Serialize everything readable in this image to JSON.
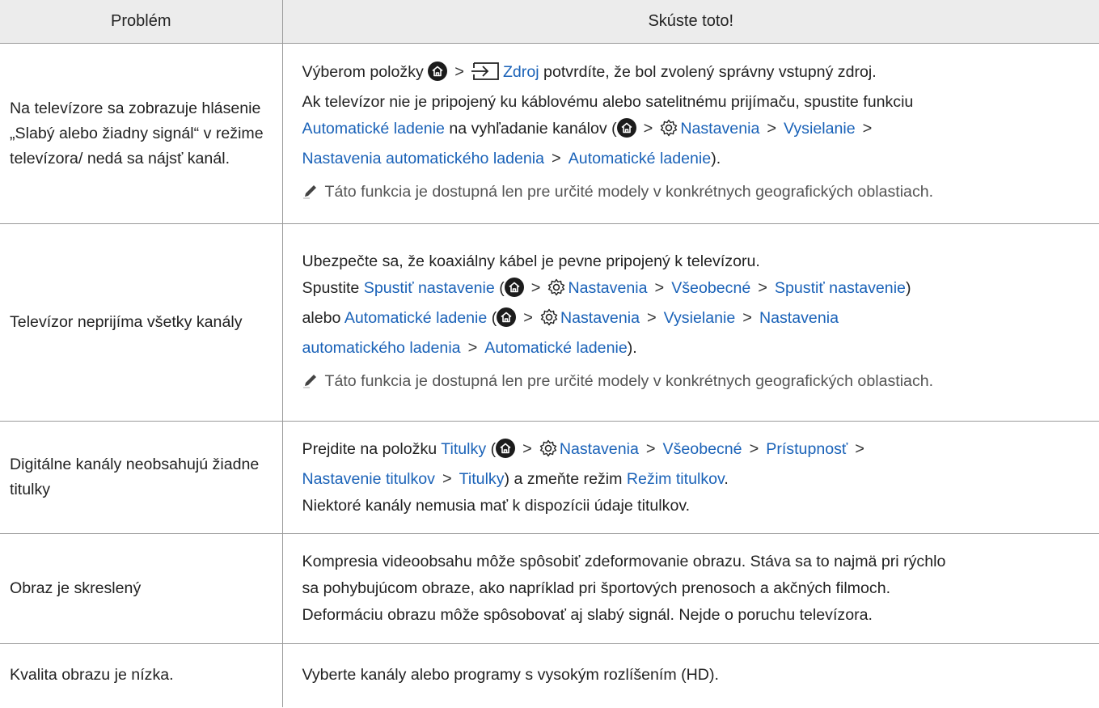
{
  "table": {
    "header": {
      "problem": "Problém",
      "solution": "Skúste toto!"
    },
    "r1": {
      "problem": "Na televízore sa zobrazuje hlásenie „Slabý alebo žiadny signál“ v režime televízora/ nedá sa nájsť kanál.",
      "l1_a": "Výberom položky",
      "l1_zdroj": "Zdroj",
      "l1_b": "potvrdíte, že bol zvolený správny vstupný zdroj.",
      "l2": "Ak televízor nie je pripojený ku káblovému alebo satelitnému prijímaču, spustite funkciu",
      "l3_auto": "Automatické ladenie",
      "l3_text": "na vyhľadanie kanálov (",
      "l3_nast": "Nastavenia",
      "l3_vys": "Vysielanie",
      "l4_nal": "Nastavenia automatického ladenia",
      "l4_auto": "Automatické ladenie",
      "l4_end": ").",
      "note": "Táto funkcia je dostupná len pre určité modely v konkrétnych geografických oblastiach."
    },
    "r2": {
      "problem": "Televízor neprijíma všetky kanály",
      "l1": "Ubezpečte sa, že koaxiálny kábel je pevne pripojený k televízoru.",
      "l2_a": "Spustite",
      "l2_spustit": "Spustiť nastavenie",
      "l2_paren": "(",
      "l2_nast": "Nastavenia",
      "l2_vseob": "Všeobecné",
      "l2_spustit2": "Spustiť nastavenie",
      "l2_end": ")",
      "l3_a": "alebo",
      "l3_auto": "Automatické ladenie",
      "l3_paren": "(",
      "l3_nast": "Nastavenia",
      "l3_vys": "Vysielanie",
      "l3_nast2": "Nastavenia",
      "l4_aut": "automatického ladenia",
      "l4_auto": "Automatické ladenie",
      "l4_end": ").",
      "note": "Táto funkcia je dostupná len pre určité modely v konkrétnych geografických oblastiach."
    },
    "r3": {
      "problem": "Digitálne kanály neobsahujú žiadne titulky",
      "l1_a": "Prejdite na položku",
      "l1_tit": "Titulky",
      "l1_paren": "(",
      "l1_nast": "Nastavenia",
      "l1_vseob": "Všeobecné",
      "l1_prist": "Prístupnosť",
      "l2_nastit": "Nastavenie titulkov",
      "l2_tit": "Titulky",
      "l2_mid": ") a zmeňte režim",
      "l2_rezim": "Režim titulkov",
      "l2_end": ".",
      "l3": "Niektoré kanály nemusia mať k dispozícii údaje titulkov."
    },
    "r4": {
      "problem": "Obraz je skreslený",
      "l1": "Kompresia videoobsahu môže spôsobiť zdeformovanie obrazu. Stáva sa to najmä pri rýchlo",
      "l2": "sa pohybujúcom obraze, ako napríklad pri športových prenosoch a akčných filmoch.",
      "l3": "Deformáciu obrazu môže spôsobovať aj slabý signál. Nejde o poruchu televízora."
    },
    "r5": {
      "problem": "Kvalita obrazu je nízka.",
      "l1": "Vyberte kanály alebo programy s vysokým rozlíšením (HD)."
    },
    "chevron": ">",
    "colors": {
      "link": "#1a62b8",
      "header_bg": "#ececec",
      "border": "#9a9a9a"
    },
    "icons": [
      "home-icon",
      "source-icon",
      "gear-icon",
      "pencil-icon"
    ]
  }
}
